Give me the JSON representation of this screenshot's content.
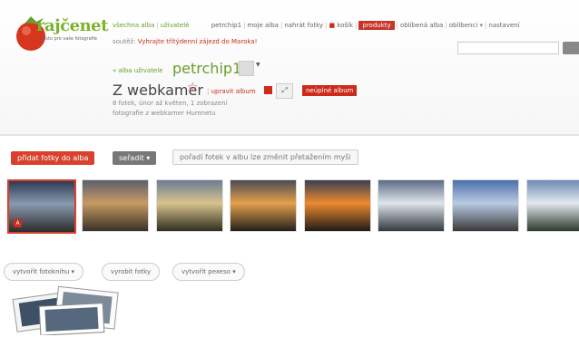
{
  "logo": {
    "brand": "rajčenet",
    "tagline": "místo pro vaše fotografie"
  },
  "topnav": {
    "all_albums": "všechna alba",
    "users": "uživatelé",
    "user_link": "petrchip1",
    "my_albums": "moje alba",
    "upload": "nahrát fotky",
    "cart": "košík",
    "products": "produkty",
    "fav_albums": "oblíbená alba",
    "favorites": "oblíbenci",
    "settings": "nastavení"
  },
  "contest": {
    "label": "soutěž:",
    "text": "Vyhrajte třítýdenní zájezd do Maroka!"
  },
  "album": {
    "breadcrumb": "« alba uživatele",
    "user": "petrchip1",
    "title": "Z webkamer",
    "edit": "upravit album",
    "incomplete": "neúplné album",
    "meta": "8 fotek, únor až květen, 1 zobrazení",
    "description": "fotografie z webkamer Humnetu"
  },
  "toolbar": {
    "add_photos": "přidat fotky do alba",
    "sort": "seřadit ▾",
    "hint": "pořadí fotek v albu lze změnit přetažením myši"
  },
  "thumbnails": [
    {
      "name": "photo-1",
      "colors": [
        "#2c3b52",
        "#8a9ab0",
        "#2b2b2b"
      ]
    },
    {
      "name": "photo-2",
      "colors": [
        "#5d5f6d",
        "#c79a63",
        "#3a3027"
      ]
    },
    {
      "name": "photo-3",
      "colors": [
        "#6b7c94",
        "#d9c38d",
        "#2e3020"
      ]
    },
    {
      "name": "photo-4",
      "colors": [
        "#4a4b52",
        "#e4a04c",
        "#24201c"
      ]
    },
    {
      "name": "photo-5",
      "colors": [
        "#3a3f50",
        "#ed8a2f",
        "#1f1b18"
      ]
    },
    {
      "name": "photo-6",
      "colors": [
        "#5a6c86",
        "#dfe5ec",
        "#343a3f"
      ]
    },
    {
      "name": "photo-7",
      "colors": [
        "#4a6fa8",
        "#b9cbe3",
        "#3a3a3a"
      ]
    },
    {
      "name": "photo-8",
      "colors": [
        "#6c8bb4",
        "#e3e8ee",
        "#2c3a2a"
      ]
    }
  ],
  "products": {
    "photobook": "vytvořit fotoknihu ▾",
    "prints": "vyrobit fotky",
    "pexeso": "vytvořit pexeso ▾"
  }
}
